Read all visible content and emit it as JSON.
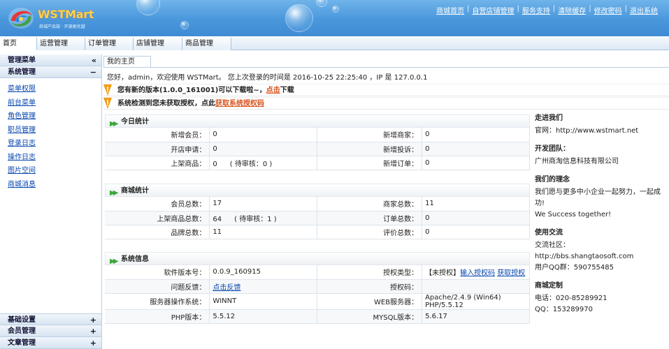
{
  "header": {
    "logo_brand": "WSTMart",
    "logo_tagline": "商城产品链 · 开源更优越",
    "links": [
      "商城首页",
      "自营店铺管理",
      "服务支持",
      "清除缓存",
      "修改密码",
      "退出系统"
    ],
    "link_separator": "|"
  },
  "tabs": [
    "首页",
    "运营管理",
    "订单管理",
    "店铺管理",
    "商品管理"
  ],
  "sidebar": {
    "menu_title": "管理菜单",
    "menu_toggle": "«",
    "group_title": "系统管理",
    "group_toggle": "−",
    "items": [
      "菜单权限",
      "前台菜单",
      "角色管理",
      "职员管理",
      "登录日志",
      "操作日志",
      "图片空间",
      "商城消息"
    ],
    "bottom_groups": [
      {
        "label": "基础设置",
        "toggle": "+"
      },
      {
        "label": "会员管理",
        "toggle": "+"
      },
      {
        "label": "文章管理",
        "toggle": "+"
      }
    ]
  },
  "content": {
    "tab": "我的主页",
    "welcome": "您好，admin，欢迎使用 WSTMart。 您上次登录的时间是 2016-10-25 22:25:40 ，IP 是 127.0.0.1",
    "notice_update": {
      "text": "您有新的版本(1.0.0_161001)可以下载啦~，",
      "link": "点击",
      "suffix": "下载"
    },
    "notice_license": {
      "text": "系统检测到您未获取授权，点此",
      "link": "获取系统授权码"
    }
  },
  "today_stats": {
    "title": "今日统计",
    "rows": [
      {
        "k1": "新增会员：",
        "v1": "0",
        "k2": "新增商家：",
        "v2": "0"
      },
      {
        "k1": "开店申请：",
        "v1": "0",
        "k2": "新增投诉：",
        "v2": "0"
      },
      {
        "k1": "上架商品：",
        "v1": "0",
        "a1": "( 待审核：0 )",
        "k2": "新增订单：",
        "v2": "0"
      }
    ]
  },
  "mall_stats": {
    "title": "商城统计",
    "rows": [
      {
        "k1": "会员总数：",
        "v1": "17",
        "k2": "商家总数：",
        "v2": "11"
      },
      {
        "k1": "上架商品总数：",
        "v1": "64",
        "a1": "( 待审核：1 )",
        "k2": "订单总数：",
        "v2": "0"
      },
      {
        "k1": "品牌总数：",
        "v1": "11",
        "k2": "评价总数：",
        "v2": "0"
      }
    ]
  },
  "system_info": {
    "title": "系统信息",
    "software_version_label": "软件版本号：",
    "software_version": "0.0.9_160915",
    "license_type_label": "授权类型：",
    "license_type": "【未授权】",
    "input_license_link": "输入授权码",
    "get_license_link": "获取授权",
    "feedback_label": "问题反馈：",
    "feedback_link": "点击反馈",
    "license_code_label": "授权码：",
    "license_code": "",
    "os_label": "服务器操作系统：",
    "os": "WINNT",
    "web_server_label": "WEB服务器：",
    "web_server": "Apache/2.4.9 (Win64) PHP/5.5.12",
    "php_label": "PHP版本：",
    "php": "5.5.12",
    "mysql_label": "MYSQL版本：",
    "mysql": "5.6.17"
  },
  "info_panel": [
    {
      "title": "走进我们",
      "lines": [
        "官网：http://www.wstmart.net"
      ]
    },
    {
      "title": "开发团队：",
      "lines": [
        "广州商淘信息科技有限公司"
      ]
    },
    {
      "title": "我们的理念",
      "lines": [
        "我们愿与更多中小企业一起努力，一起成功!",
        "We Success together!"
      ]
    },
    {
      "title": "使用交流",
      "lines": [
        "交流社区：http://bbs.shangtaosoft.com",
        "用户QQ群：590755485"
      ]
    },
    {
      "title": "商城定制",
      "lines": [
        "电话：020-85289921",
        "QQ：153289970"
      ]
    }
  ],
  "colors": {
    "header_blue": "#4a97dc",
    "link": "#0645ad",
    "notice_link": "#d9531e",
    "flag": "#f39c12"
  }
}
